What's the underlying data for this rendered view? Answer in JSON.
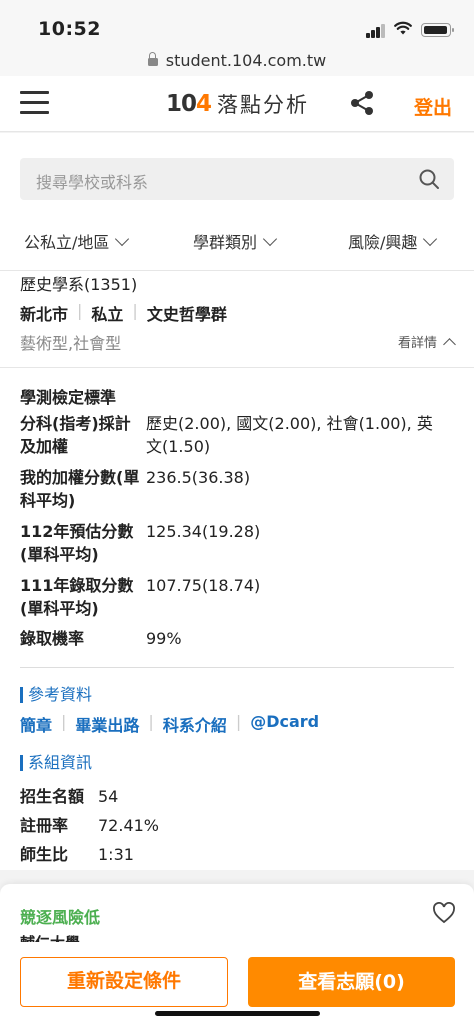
{
  "status": {
    "time": "10:52"
  },
  "browser": {
    "url": "student.104.com.tw"
  },
  "header": {
    "logo_prefix": "10",
    "logo_accent": "4",
    "title": "落點分析",
    "logout_label": "登出"
  },
  "search": {
    "placeholder": "搜尋學校或科系"
  },
  "filters": [
    {
      "label": "公私立/地區"
    },
    {
      "label": "學群類別"
    },
    {
      "label": "風險/興趣"
    }
  ],
  "result": {
    "department": "歷史學系(1351)",
    "city": "新北市",
    "ownership": "私立",
    "group": "文史哲學群",
    "types": "藝術型,社會型",
    "detail_label": "看詳情",
    "standard_title": "學測檢定標準",
    "rows": [
      {
        "label": "分科(指考)採計及加權",
        "value": "歷史(2.00), 國文(2.00), 社會(1.00), 英文(1.50)"
      },
      {
        "label": "我的加權分數(單科平均)",
        "value": "236.5(36.38)"
      },
      {
        "label": "112年預估分數(單科平均)",
        "value": "125.34(19.28)"
      },
      {
        "label": "111年錄取分數(單科平均)",
        "value": "107.75(18.74)"
      },
      {
        "label": "錄取機率",
        "value": "99%"
      }
    ],
    "references_title": "參考資料",
    "links": [
      "簡章",
      "畢業出路",
      "科系介紹",
      "@Dcard"
    ],
    "info_title": "系組資訊",
    "info": [
      {
        "label": "招生名額",
        "value": "54"
      },
      {
        "label": "註冊率",
        "value": "72.41%"
      },
      {
        "label": "師生比",
        "value": "1:31"
      }
    ]
  },
  "next_card": {
    "risk": "競逐風險低",
    "school": "輔仁大學"
  },
  "actions": {
    "reset_label": "重新設定條件",
    "view_label": "查看志願(0)"
  },
  "colors": {
    "accent": "#ff7800",
    "link": "#1a6fbf",
    "risk_low": "#4caf50"
  }
}
